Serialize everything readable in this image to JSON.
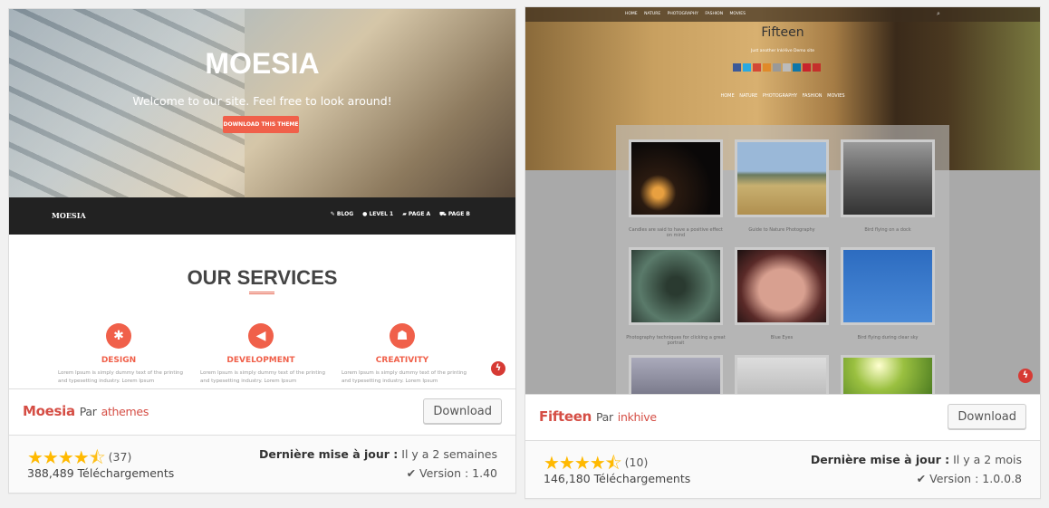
{
  "themes": [
    {
      "name": "Moesia",
      "by": "Par",
      "author": "athemes",
      "download_label": "Download",
      "rating": 4.5,
      "rating_count": "(37)",
      "downloads": "388,489 Téléchargements",
      "updated_label": "Dernière mise à jour :",
      "updated_value": "Il y a 2 semaines",
      "version": "Version : 1.40",
      "preview": {
        "title": "MOESIA",
        "subtitle": "Welcome to our site. Feel free to look around!",
        "button": "DOWNLOAD THIS THEME",
        "logo": "MOESIA",
        "nav": [
          "BLOG",
          "LEVEL 1",
          "PAGE A",
          "PAGE B"
        ],
        "section_title": "OUR SERVICES",
        "services": [
          {
            "title": "DESIGN",
            "icon": "bug-icon",
            "text": "Lorem Ipsum is simply dummy text of the printing and typesetting industry. Lorem Ipsum"
          },
          {
            "title": "DEVELOPMENT",
            "icon": "megaphone-icon",
            "text": "Lorem Ipsum is simply dummy text of the printing and typesetting industry. Lorem Ipsum"
          },
          {
            "title": "CREATIVITY",
            "icon": "android-icon",
            "text": "Lorem Ipsum is simply dummy text of the printing and typesetting industry. Lorem Ipsum"
          }
        ]
      }
    },
    {
      "name": "Fifteen",
      "by": "Par",
      "author": "inkhive",
      "download_label": "Download",
      "rating": 4.5,
      "rating_count": "(10)",
      "downloads": "146,180 Téléchargements",
      "updated_label": "Dernière mise à jour :",
      "updated_value": "Il y a 2 mois",
      "version": "Version : 1.0.0.8",
      "preview": {
        "top_nav": "HOME NATURE PHOTOGRAPHY FASHION MOVIES",
        "title": "Fifteen",
        "tagline": "Just another InkHive Demo site",
        "nav": "HOME NATURE PHOTOGRAPHY FASHION MOVIES",
        "captions": [
          "Candles are said to have a positive effect on mind",
          "Guide to Nature Photography",
          "Bird flying on a dock",
          "Photography techniques for clicking a great portrait",
          "Blue Eyes",
          "Bird flying during clear sky"
        ]
      }
    }
  ],
  "colors": {
    "accent": "#d54e45",
    "star": "#ffb900",
    "moesia_orange": "#f0604a"
  }
}
